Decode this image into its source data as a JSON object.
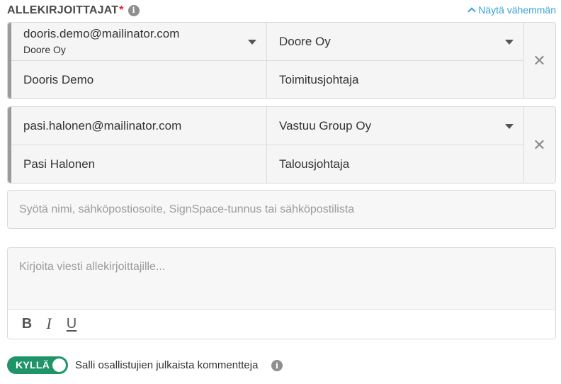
{
  "header": {
    "title": "ALLEKIRJOITTAJAT",
    "required_mark": "*",
    "info_icon": "i",
    "show_less_label": "Näytä vähemmän"
  },
  "signers": [
    {
      "email": "dooris.demo@mailinator.com",
      "email_org": "Doore Oy",
      "organization": "Doore Oy",
      "name": "Dooris Demo",
      "title": "Toimitusjohtaja",
      "remove_label": "✕"
    },
    {
      "email": "pasi.halonen@mailinator.com",
      "organization": "Vastuu Group Oy",
      "name": "Pasi Halonen",
      "title": "Talousjohtaja",
      "remove_label": "✕"
    }
  ],
  "signer_input": {
    "placeholder": "Syötä nimi, sähköpostiosoite, SignSpace-tunnus tai sähköpostilista"
  },
  "message": {
    "placeholder": "Kirjoita viesti allekirjoittajille...",
    "toolbar": {
      "bold": "B",
      "italic": "I",
      "underline": "U"
    }
  },
  "comments": {
    "toggle_label": "KYLLÄ",
    "toggle_on": true,
    "label": "Salli osallistujien julkaista kommentteja",
    "info_icon": "i"
  },
  "colors": {
    "link": "#3aa0d6",
    "toggle_on": "#1f9468",
    "required": "#e0262f"
  }
}
